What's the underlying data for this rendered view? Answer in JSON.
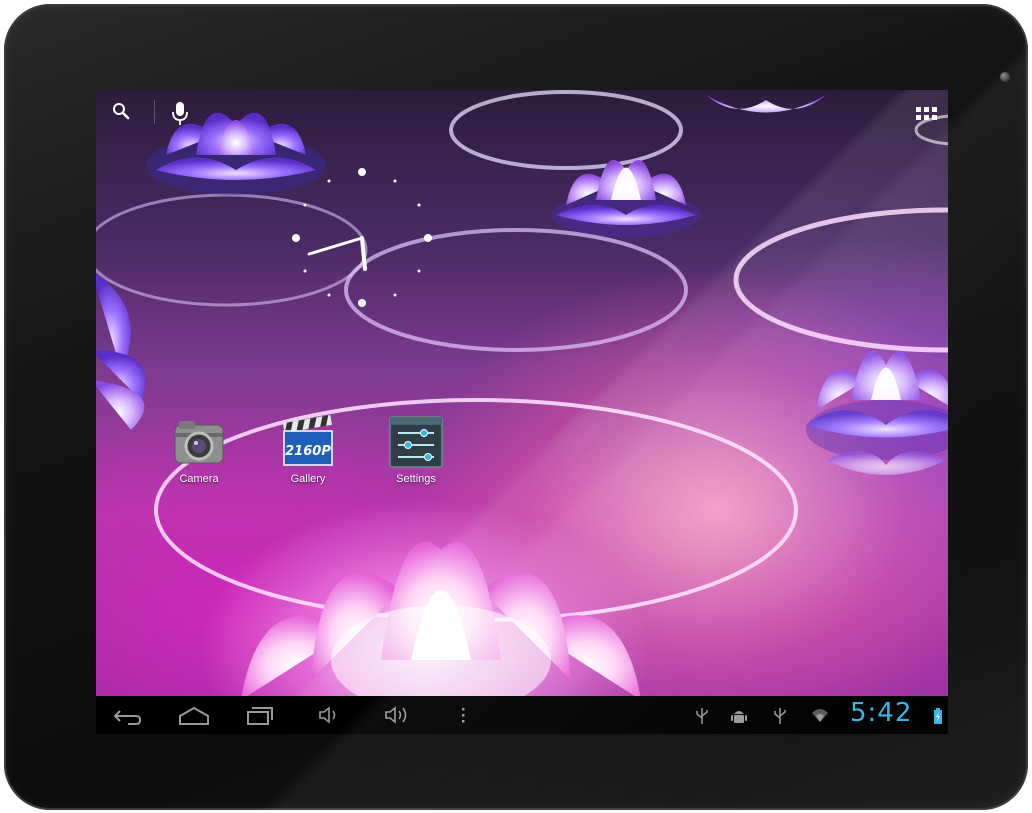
{
  "colors": {
    "bezel": "#141414",
    "navbar": "#000000",
    "clock_accent": "#33b5e5",
    "label_text": "#ffffff",
    "icon_gray": "#9a9a9a"
  },
  "top_bar": {
    "search_icon": "search-icon",
    "voice_icon": "microphone-icon",
    "apps_icon": "app-grid-icon"
  },
  "clock_widget": {
    "type": "analog-clock"
  },
  "shortcuts": [
    {
      "label": "Camera",
      "icon": "camera-icon"
    },
    {
      "label": "Gallery",
      "icon": "gallery-clapperboard-icon",
      "icon_text": "2160P"
    },
    {
      "label": "Settings",
      "icon": "settings-sliders-icon"
    }
  ],
  "navbar": {
    "buttons": [
      {
        "name": "back",
        "icon": "back-arrow-icon"
      },
      {
        "name": "home",
        "icon": "home-icon"
      },
      {
        "name": "recent-apps",
        "icon": "recent-apps-icon"
      },
      {
        "name": "volume-down",
        "icon": "volume-down-icon"
      },
      {
        "name": "volume-up",
        "icon": "volume-up-icon"
      },
      {
        "name": "menu",
        "icon": "overflow-menu-icon"
      }
    ],
    "status_icons": [
      "usb-icon",
      "android-debug-icon",
      "usb-icon",
      "wifi-icon",
      "battery-charging-icon"
    ],
    "time": "5:42"
  }
}
